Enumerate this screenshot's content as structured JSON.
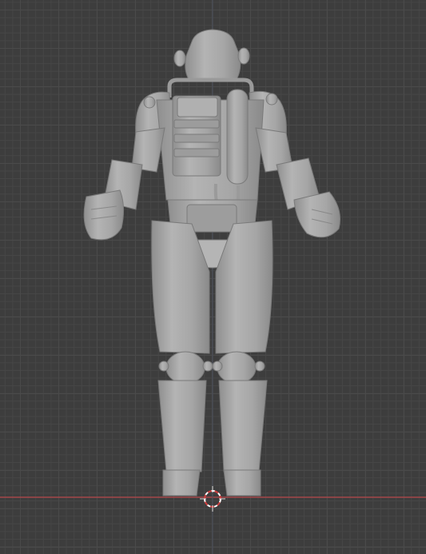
{
  "viewport": {
    "view": "back-orthographic",
    "background_color": "#3d3d3d",
    "grid_color": "#4a4a4a",
    "x_axis_color": "#c0504d",
    "model_color": "#a9a9a9",
    "cursor_color": "#ffffff",
    "cursor_accent_color": "#d04040"
  },
  "model": {
    "name_icon": "power-armor-model",
    "view_side": "back"
  },
  "icons": {
    "cursor": "3d-cursor-icon"
  }
}
